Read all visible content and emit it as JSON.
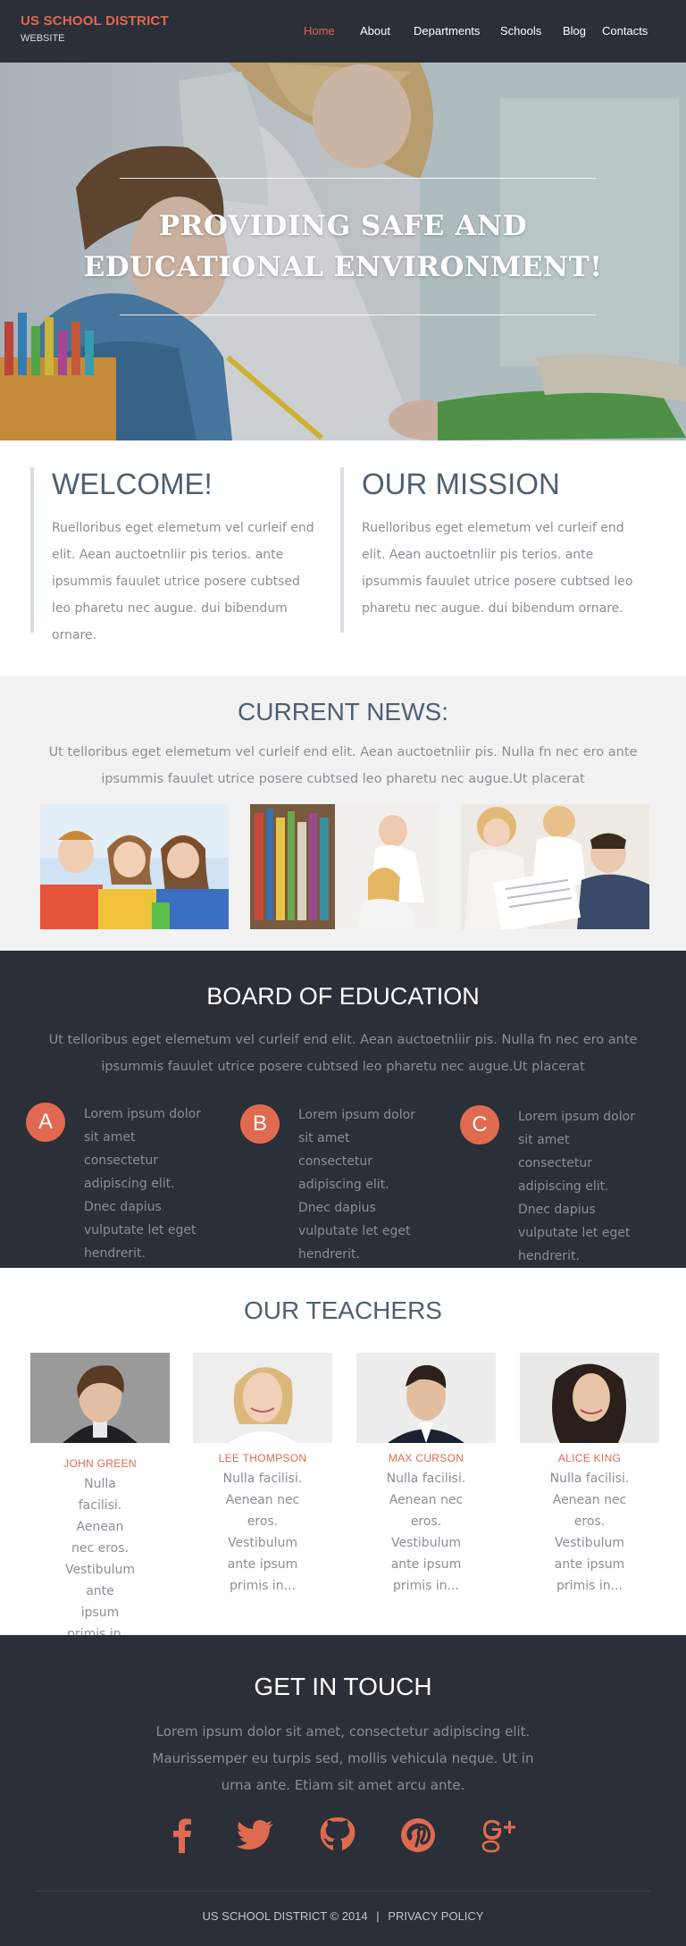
{
  "header": {
    "brand": "US SCHOOL DISTRICT",
    "brand_sub": "WEBSITE",
    "nav": {
      "home": "Home",
      "about": "About",
      "departments": "Departments",
      "schools": "Schools",
      "blog": "Blog",
      "contacts": "Contacts"
    },
    "active_item": "Home"
  },
  "hero": {
    "line1": "PROVIDING SAFE AND",
    "line2": "EDUCATIONAL ENVIRONMENT!"
  },
  "welcome": {
    "title": "WELCOME!",
    "text": "Ruelloribus eget elemetum vel curleif end elit. Aean auctoetnliir pis terios. ante ipsummis fauulet utrice posere cubtsed leo pharetu nec augue. dui bibendum ornare."
  },
  "mission": {
    "title": "OUR MISSION",
    "text": "Ruelloribus eget elemetum vel curleif end elit. Aean auctoetnliir pis terios. ante ipsummis fauulet utrice posere cubtsed leo pharetu nec augue. dui bibendum ornare."
  },
  "news": {
    "title": "CURRENT NEWS:",
    "text": "Ut telloribus eget elemetum vel curleif end elit. Aean auctoetnliir pis. Nulla fn nec ero ante ipsummis fauulet utrice posere cubtsed leo pharetu nec augue.Ut placerat"
  },
  "board": {
    "title": "BOARD OF EDUCATION",
    "text": "Ut telloribus eget elemetum vel curleif end elit. Aean auctoetnliir pis. Nulla fn nec ero ante ipsummis fauulet utrice posere cubtsed leo pharetu nec augue.Ut placerat",
    "items": [
      {
        "badge": "A",
        "text": "Lorem ipsum dolor sit amet consectetur adipiscing elit. Dnec dapius vulputate let eget hendrerit."
      },
      {
        "badge": "B",
        "text": "Lorem ipsum dolor sit amet consectetur adipiscing elit. Dnec dapius vulputate let eget hendrerit."
      },
      {
        "badge": "C",
        "text": "Lorem ipsum dolor sit amet consectetur adipiscing elit. Dnec dapius vulputate let eget hendrerit."
      }
    ]
  },
  "teachers": {
    "title": "OUR TEACHERS",
    "items": [
      {
        "name": "JOHN GREEN",
        "text": "Nulla facilisi. Aenean nec eros. Vestibulum ante ipsum primis in..."
      },
      {
        "name": "LEE THOMPSON",
        "text": "Nulla facilisi. Aenean nec eros. Vestibulum ante ipsum primis in..."
      },
      {
        "name": "MAX CURSON",
        "text": "Nulla facilisi. Aenean nec eros. Vestibulum ante ipsum primis in..."
      },
      {
        "name": "ALICE KING",
        "text": "Nulla facilisi. Aenean nec eros. Vestibulum ante ipsum primis in..."
      }
    ]
  },
  "contact": {
    "title": "GET IN TOUCH",
    "text": "Lorem ipsum dolor sit amet, consectetur adipiscing elit. Maurissemper eu turpis sed, mollis vehicula neque. Ut in urna ante. Etiam sit amet arcu ante.",
    "social": [
      "facebook-icon",
      "twitter-icon",
      "github-icon",
      "pinterest-icon",
      "google-plus-icon"
    ]
  },
  "footer": {
    "copyright": "US SCHOOL DISTRICT © 2014",
    "separator": "|",
    "privacy": "PRIVACY POLICY"
  },
  "colors": {
    "accent": "#e06a4f",
    "dark": "#2a2f38",
    "heading": "#4d6075",
    "body_text": "#8a8f96",
    "light_bg": "#f2f2f2"
  }
}
